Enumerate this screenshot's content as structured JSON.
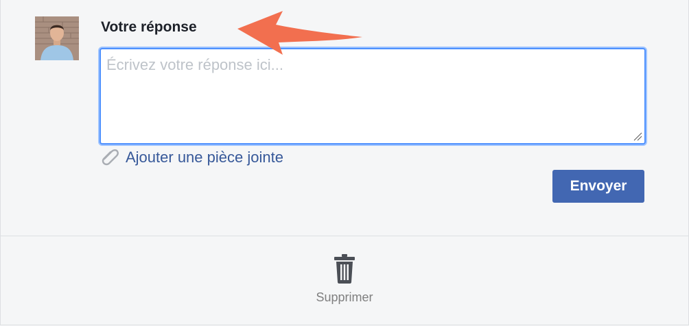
{
  "reply": {
    "title": "Votre réponse",
    "placeholder": "Écrivez votre réponse ici...",
    "value": ""
  },
  "attachment": {
    "label": "Ajouter une pièce jointe",
    "icon": "paperclip-icon"
  },
  "send_button": {
    "label": "Envoyer"
  },
  "delete_action": {
    "label": "Supprimer",
    "icon": "trash-icon"
  },
  "colors": {
    "accent": "#4267b2",
    "link": "#365899",
    "focus": "#4d90fe",
    "annotation_arrow": "#f26f4f"
  }
}
